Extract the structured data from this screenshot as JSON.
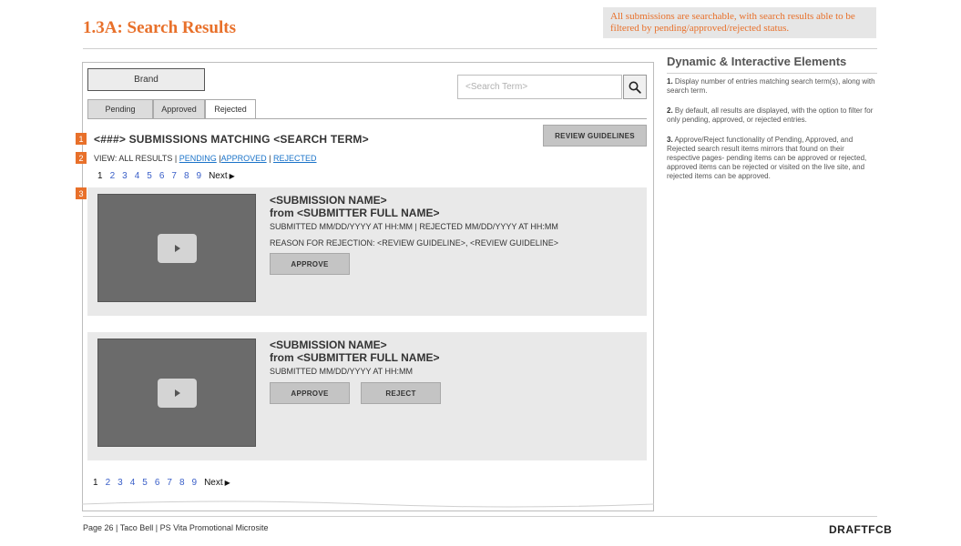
{
  "header": {
    "title": "1.3A: Search Results",
    "callout": "All submissions are searchable, with search results able to be filtered by pending/approved/rejected status."
  },
  "wireframe": {
    "brand": "Brand",
    "search": {
      "placeholder": "<Search Term>"
    },
    "tabs": [
      {
        "label": "Pending",
        "active": false
      },
      {
        "label": "Approved",
        "active": false
      },
      {
        "label": "Rejected",
        "active": true
      }
    ],
    "markers": [
      "1",
      "2",
      "3"
    ],
    "results_heading": "<###> SUBMISSIONS MATCHING <SEARCH TERM>",
    "review_guidelines_label": "REVIEW GUIDELINES",
    "view": {
      "prefix": "VIEW: ALL RESULTS |",
      "pending": "PENDING",
      "sep1": "|",
      "approved": "APPROVED",
      "sep2": "|",
      "rejected": "REJECTED"
    },
    "pagination": {
      "pages": [
        "1",
        "2",
        "3",
        "4",
        "5",
        "6",
        "7",
        "8",
        "9"
      ],
      "current": "1",
      "next": "Next"
    },
    "results": [
      {
        "name": "<SUBMISSION NAME>",
        "from": "from <SUBMITTER FULL NAME>",
        "submitted": "SUBMITTED MM/DD/YYYY AT HH:MM | REJECTED MM/DD/YYYY AT HH:MM",
        "reason": "REASON FOR REJECTION: <REVIEW GUIDELINE>, <REVIEW GUIDELINE>",
        "approve_label": "APPROVE"
      },
      {
        "name": "<SUBMISSION NAME>",
        "from": "from <SUBMITTER FULL NAME>",
        "submitted": "SUBMITTED MM/DD/YYYY AT HH:MM",
        "approve_label": "APPROVE",
        "reject_label": "REJECT"
      }
    ]
  },
  "sidebar": {
    "title": "Dynamic & Interactive Elements",
    "notes": [
      {
        "num": "1.",
        "text": "Display number of entries matching search term(s), along with search term."
      },
      {
        "num": "2.",
        "text": "By default, all results are displayed, with the option to filter for only pending, approved, or rejected entries."
      },
      {
        "num": "3.",
        "text": "Approve/Reject functionality of Pending, Approved, and Rejected search result items mirrors that found on their respective pages- pending items can be approved or rejected, approved items can be rejected or visited on the live site, and rejected items can be approved."
      }
    ]
  },
  "footer": {
    "left": "Page 26 | Taco Bell | PS Vita Promotional Microsite",
    "logo": "DRAFTFCB"
  },
  "colors": {
    "accent": "#e8702a",
    "link": "#1a73c9",
    "card_bg": "#e9e9e9",
    "thumb": "#6b6b6b"
  },
  "icons": {
    "search": "magnifier-icon",
    "play": "play-icon",
    "next": "triangle-right-icon"
  }
}
